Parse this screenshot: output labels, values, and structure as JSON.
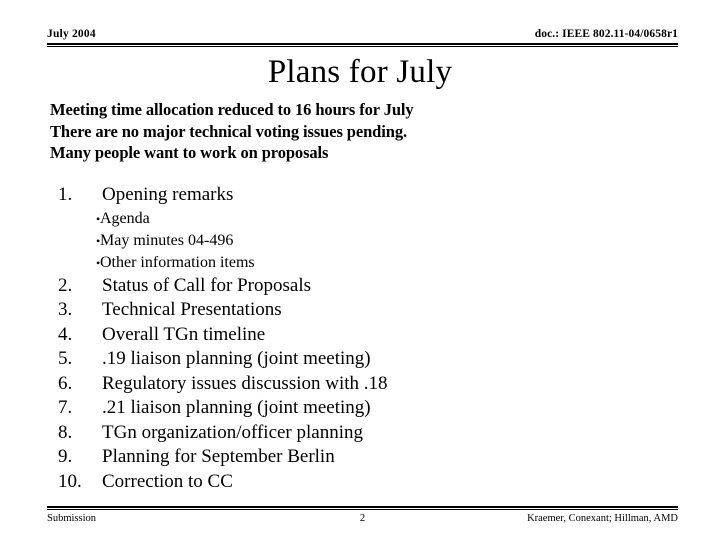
{
  "header": {
    "date": "July 2004",
    "doc": "doc.: IEEE 802.11-04/0658r1"
  },
  "title": "Plans for July",
  "intro": {
    "line1": "Meeting time allocation reduced to 16 hours for July",
    "line2": "There are no major technical voting issues pending.",
    "line3": "Many people want to work on proposals"
  },
  "outline": [
    {
      "num": "1.",
      "text": "Opening remarks",
      "subitems": [
        {
          "bullet": "•",
          "text": "Agenda"
        },
        {
          "bullet": "•",
          "text": "May minutes 04-496"
        },
        {
          "bullet": "•",
          "text": "Other information items"
        }
      ]
    },
    {
      "num": "2.",
      "text": "Status of Call for Proposals"
    },
    {
      "num": "3.",
      "text": "Technical Presentations"
    },
    {
      "num": "4.",
      "text": "Overall TGn timeline"
    },
    {
      "num": "5.",
      "text": ".19 liaison planning (joint meeting)"
    },
    {
      "num": "6.",
      "text": "Regulatory issues discussion with .18"
    },
    {
      "num": "7.",
      "text": ".21 liaison planning (joint meeting)"
    },
    {
      "num": "8.",
      "text": "TGn organization/officer planning"
    },
    {
      "num": "9.",
      "text": "Planning for September Berlin"
    },
    {
      "num": "10.",
      "text": "Correction to CC"
    }
  ],
  "footer": {
    "left": "Submission",
    "page": "2",
    "right": "Kraemer, Conexant; Hillman, AMD"
  },
  "colors": {
    "background": "#ffffff",
    "text": "#000000",
    "rule": "#000000"
  }
}
